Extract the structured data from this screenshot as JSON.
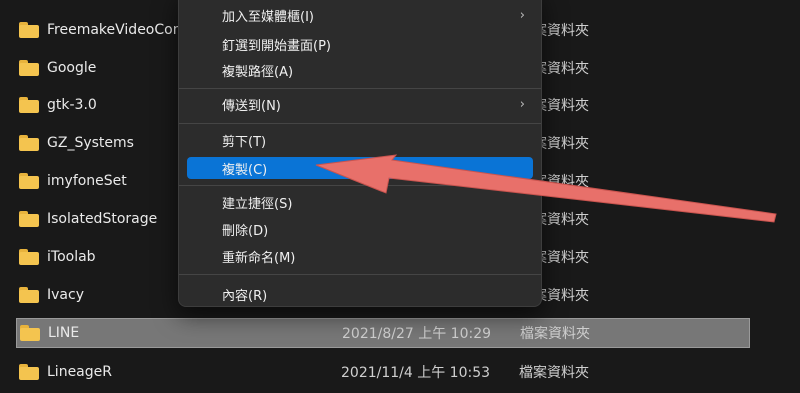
{
  "files": [
    {
      "name": "FreemakeVideoConverter",
      "date": "",
      "type": "檔案資料夾"
    },
    {
      "name": "Google",
      "date": "",
      "type": "檔案資料夾"
    },
    {
      "name": "gtk-3.0",
      "date": "",
      "type": "檔案資料夾"
    },
    {
      "name": "GZ_Systems",
      "date": "",
      "type": "檔案資料夾"
    },
    {
      "name": "imyfoneSet",
      "date": "",
      "type": "檔案資料夾"
    },
    {
      "name": "IsolatedStorage",
      "date": "",
      "type": "檔案資料夾"
    },
    {
      "name": "iToolab",
      "date": "",
      "type": "檔案資料夾"
    },
    {
      "name": "Ivacy",
      "date": "",
      "type": "檔案資料夾"
    },
    {
      "name": "LINE",
      "date": "2021/8/27 上午 10:29",
      "type": "檔案資料夾"
    },
    {
      "name": "LineageR",
      "date": "2021/11/4 上午 10:53",
      "type": "檔案資料夾"
    }
  ],
  "menu": {
    "add_to_library": "加入至媒體櫃(I)",
    "pin_to_start": "釘選到開始畫面(P)",
    "copy_path": "複製路徑(A)",
    "send_to": "傳送到(N)",
    "cut": "剪下(T)",
    "copy": "複製(C)",
    "create_shortcut": "建立捷徑(S)",
    "delete": "刪除(D)",
    "rename": "重新命名(M)",
    "properties": "內容(R)",
    "submenu_arrow": "›"
  },
  "colors": {
    "background": "#191919",
    "menu_background": "#2c2c2c",
    "highlight": "#0a74d6",
    "folder": "#f4c44f",
    "arrow": "#e8706a"
  }
}
